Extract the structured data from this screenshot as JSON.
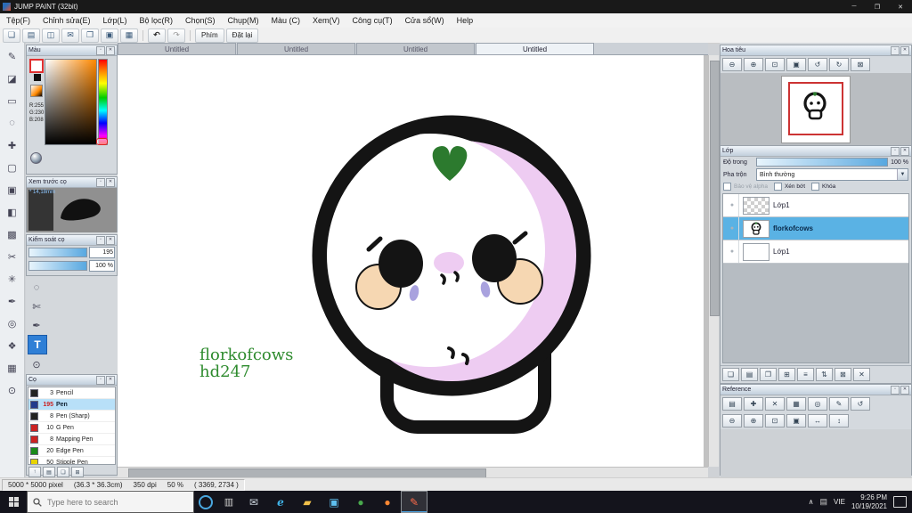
{
  "window": {
    "title": "JUMP PAINT (32bit)"
  },
  "menubar": {
    "items": [
      "Tệp(F)",
      "Chỉnh sửa(E)",
      "Lớp(L)",
      "Bộ lọc(R)",
      "Chọn(S)",
      "Chụp(M)",
      "Màu (C)",
      "Xem(V)",
      "Công cụ(T)",
      "Cửa sổ(W)",
      "Help"
    ]
  },
  "toolbar": {
    "keys_button": "Phím",
    "reset_button": "Đặt lại"
  },
  "tabs": {
    "items": [
      "Untitled",
      "Untitled",
      "Untitled",
      "Untitled"
    ]
  },
  "color_panel": {
    "title": "Màu",
    "r": "R:255",
    "g": "G:230",
    "b": "B:208"
  },
  "brush_preview_panel": {
    "title": "Xem trước cọ",
    "size_label": "* 14,18mm"
  },
  "brush_control_panel": {
    "title": "Kiểm soát cọ",
    "size_value": "195",
    "opacity_value": "100 %"
  },
  "brush_panel": {
    "title": "Cọ",
    "rows": [
      {
        "size": "3",
        "name": "Pencil",
        "color": "#222222"
      },
      {
        "size": "195",
        "name": "Pen",
        "color": "#223a8c"
      },
      {
        "size": "8",
        "name": "Pen (Sharp)",
        "color": "#222222"
      },
      {
        "size": "10",
        "name": "G Pen",
        "color": "#cc2222"
      },
      {
        "size": "8",
        "name": "Mapping Pen",
        "color": "#cc2222"
      },
      {
        "size": "20",
        "name": "Edge Pen",
        "color": "#1a8a1a"
      },
      {
        "size": "50",
        "name": "Stipple Pen",
        "color": "#e8d400"
      }
    ]
  },
  "navigator_panel": {
    "title": "Hoa tiêu"
  },
  "layers_panel": {
    "title": "Lớp",
    "opacity_label": "Độ trong",
    "opacity_value": "100 %",
    "blend_label": "Pha trộn",
    "blend_value": "Bình thường",
    "check_alpha": "Bảo vệ alpha",
    "check_clip": "Xén bớt",
    "check_lock": "Khóa",
    "layers": [
      {
        "name": "Lớp1"
      },
      {
        "name": "florkofcows"
      },
      {
        "name": "Lớp1"
      }
    ]
  },
  "reference_panel": {
    "title": "Reference"
  },
  "canvas": {
    "signature_line1": "florkofcows",
    "signature_line2": "hd247"
  },
  "statusbar": {
    "doc_size": "5000 * 5000 pixel",
    "doc_cm": "(36.3 * 36.3cm)",
    "dpi": "350 dpi",
    "zoom": "50 %",
    "coords": "( 3369, 2734 )"
  },
  "taskbar": {
    "search_placeholder": "Type here to search",
    "language": "VIE",
    "time": "9:26 PM",
    "date": "10/19/2021"
  },
  "colors": {
    "accent_blue": "#5ab2e4",
    "brush_selection": "#b8e0f8",
    "skull_pink": "#eeccf2",
    "sprout_green": "#2c7a2e",
    "cheek_peach": "#f6d7b2",
    "tear_lavender": "#a9a2de",
    "signature_green": "#2e8b2e"
  },
  "icons": {
    "toolstrip": [
      "pen",
      "eraser",
      "select-rect",
      "lasso",
      "move",
      "crop",
      "fill",
      "gradient",
      "tone",
      "scissors",
      "magic-wand",
      "nib",
      "target",
      "symmetry",
      "grid",
      "zoom"
    ],
    "navigator_tools": [
      "zoom-out",
      "zoom-in",
      "fit-window",
      "actual-size",
      "rotate-left",
      "rotate-right",
      "reset-view"
    ]
  }
}
